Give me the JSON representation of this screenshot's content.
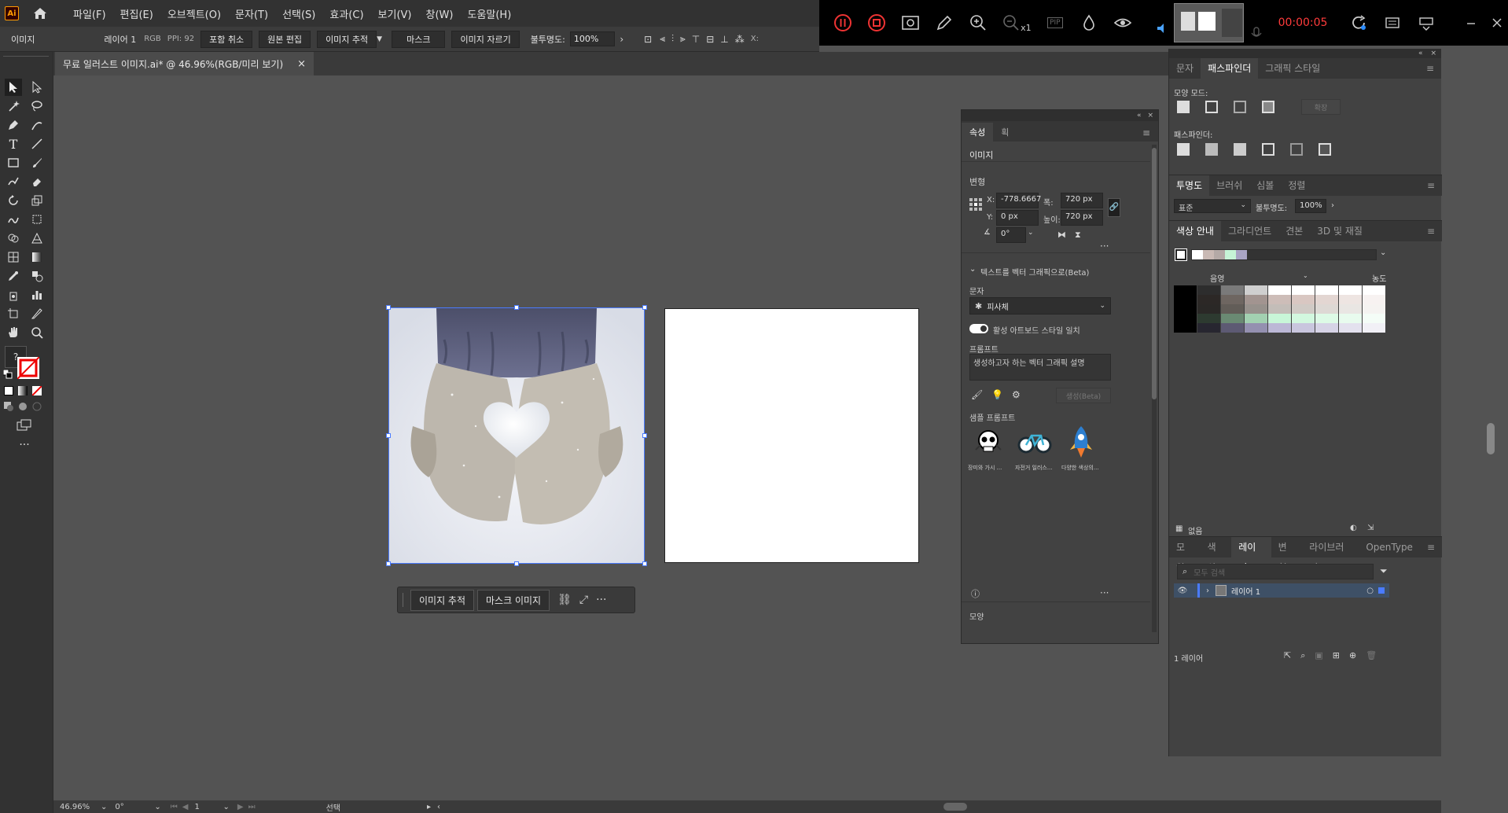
{
  "menubar": {
    "logo": "Ai",
    "items": [
      "파일(F)",
      "편집(E)",
      "오브젝트(O)",
      "문자(T)",
      "선택(S)",
      "효과(C)",
      "보기(V)",
      "창(W)",
      "도움말(H)"
    ]
  },
  "recorder": {
    "timer": "00:00:05",
    "zoom_label": "x1",
    "pip_label": "PIP"
  },
  "controlbar": {
    "selection_type": "이미지",
    "layer": "레이어 1",
    "color_mode": "RGB",
    "ppi": "PPI: 92",
    "embed": "포함 취소",
    "edit_original": "원본 편집",
    "image_trace": "이미지 추적",
    "mask": "마스크",
    "crop_image": "이미지 자르기",
    "opacity_label": "불투명도:",
    "opacity_value": "100%",
    "x_label": "X:"
  },
  "document": {
    "tab_title": "무료 일러스트 이미지.ai* @ 46.96%(RGB/미리 보기)",
    "close": "×"
  },
  "context_bar": {
    "image_trace": "이미지 추적",
    "mask_image": "마스크 이미지"
  },
  "statusbar": {
    "zoom": "46.96%",
    "rotation": "0°",
    "artboard": "1",
    "tool": "선택"
  },
  "properties_panel": {
    "tabs": [
      "속성",
      "획"
    ],
    "object_type": "이미지",
    "transform_label": "변형",
    "x_label": "X:",
    "x_value": "-778.6667",
    "y_label": "Y:",
    "y_value": "0 px",
    "w_label": "폭:",
    "w_value": "720 px",
    "h_label": "높이:",
    "h_value": "720 px",
    "angle_value": "0°",
    "text_to_vector": "텍스트를 벡터 그래픽으로(Beta)",
    "type_label": "문자",
    "subject_value": "피사체",
    "match_style": "활성 아트보드 스타일 일치",
    "prompt_label": "프롬프트",
    "prompt_placeholder": "생성하고자 하는 벡터 그래픽 설명",
    "generate_button": "생성(Beta)",
    "sample_label": "샘플 프롬프트",
    "samples": [
      "장미와 가시 ...",
      "자전거 일러스...",
      "다양한 색상의..."
    ],
    "appearance_label": "모양"
  },
  "pathfinder_panel": {
    "tabs": [
      "문자",
      "패스파인더",
      "그래픽 스타일"
    ],
    "shape_modes_label": "모양 모드:",
    "expand_button": "확장",
    "pathfinders_label": "패스파인더:"
  },
  "transparency_panel": {
    "tabs": [
      "투명도",
      "브러쉬",
      "심볼",
      "정렬"
    ],
    "blend_mode": "표준",
    "opacity_label": "불투명도:",
    "opacity_value": "100%"
  },
  "color_guide_panel": {
    "tabs": [
      "색상 안내",
      "그라디언트",
      "견본",
      "3D 및 재질"
    ],
    "shade_label": "음영",
    "tint_label": "농도",
    "none_label": "없음",
    "harmony_colors": [
      "#ffffff",
      "#c9b9b4",
      "#b4a9a6",
      "#c6f4d6",
      "#a9a4c4"
    ],
    "grid_colors": [
      [
        "#000000",
        "#2d2d2d",
        "#7a7a7a",
        "#cfcfcf",
        "#ffffff",
        "#ffffff",
        "#ffffff",
        "#ffffff",
        "#ffffff"
      ],
      [
        "#000000",
        "#2c2826",
        "#6e6661",
        "#a29490",
        "#cdbdb8",
        "#d9c7c2",
        "#e3d6d2",
        "#eee5e2",
        "#f7f2f1"
      ],
      [
        "#000000",
        "#2a2826",
        "#625d58",
        "#97918c",
        "#c3bdb8",
        "#d0cac5",
        "#ddd8d4",
        "#e9e6e3",
        "#f5f3f1"
      ],
      [
        "#000000",
        "#2d3a30",
        "#6a8a73",
        "#a2d1b1",
        "#c8f6d8",
        "#d2f8df",
        "#ddfae6",
        "#e8fbee",
        "#f4fdf7"
      ],
      [
        "#000000",
        "#272630",
        "#5d5a73",
        "#9490b0",
        "#bcb8d6",
        "#c9c6de",
        "#d6d3e6",
        "#e3e1ee",
        "#f1f0f6"
      ]
    ]
  },
  "layers_panel": {
    "tabs": [
      "모양",
      "색상",
      "레이어",
      "변형",
      "라이브러리",
      "OpenType"
    ],
    "search_placeholder": "모두 검색",
    "layer_name": "레이어 1",
    "footer": "1 레이어"
  }
}
